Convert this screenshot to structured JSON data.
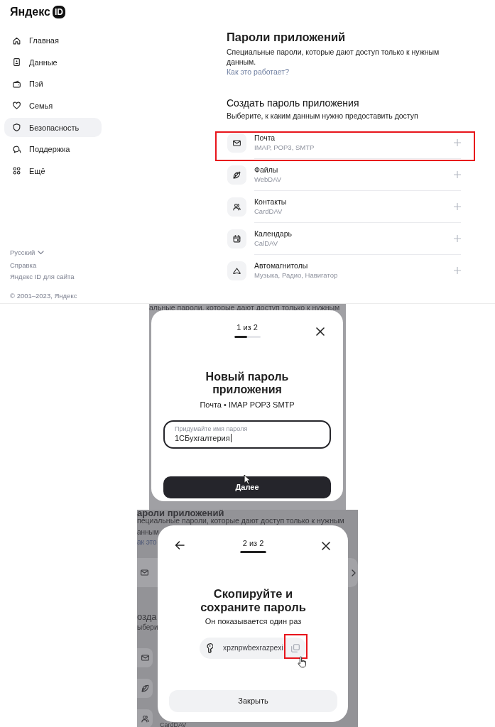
{
  "sidebar": {
    "logo": {
      "text": "Яндекс",
      "badge": "ID"
    },
    "items": [
      {
        "label": "Главная",
        "selected": false
      },
      {
        "label": "Данные",
        "selected": false
      },
      {
        "label": "Пэй",
        "selected": false
      },
      {
        "label": "Семья",
        "selected": false
      },
      {
        "label": "Безопасность",
        "selected": true
      },
      {
        "label": "Поддержка",
        "selected": false
      },
      {
        "label": "Ещё",
        "selected": false
      }
    ],
    "footer": {
      "language": "Русский",
      "links": [
        "Справка",
        "Яндекс ID для сайта"
      ],
      "copyright": "© 2001–2023, Яндекс"
    }
  },
  "main": {
    "title": "Пароли приложений",
    "description": "Специальные пароли, которые дают доступ только к нужным данным.",
    "link": "Как это работает?",
    "section_title": "Создать пароль приложения",
    "section_hint": "Выберите, к каким данным нужно предоставить доступ",
    "apps": [
      {
        "name": "Почта",
        "protocols": "IMAP, POP3, SMTP",
        "highlighted": true
      },
      {
        "name": "Файлы",
        "protocols": "WebDAV",
        "highlighted": false
      },
      {
        "name": "Контакты",
        "protocols": "CardDAV",
        "highlighted": false
      },
      {
        "name": "Календарь",
        "protocols": "CalDAV",
        "highlighted": false
      },
      {
        "name": "Автомагнитолы",
        "protocols": "Музыка, Радио, Навигатор",
        "highlighted": false
      }
    ]
  },
  "step_one": {
    "backdrop": {
      "text": "альные пароли, которые дают доступ только к нужным"
    },
    "modal": {
      "step": "1 из 2",
      "level": 0.5,
      "title": "Новый пароль приложения",
      "subtitle": "Почта • IMAP POP3 SMTP",
      "field": {
        "label": "Придумайте имя пароля",
        "value": "1СБухгалтерия"
      },
      "button": "Далее"
    }
  },
  "step_two": {
    "backdrop": {
      "title": "ароли приложений",
      "lines": [
        "пециальные пароли, которые дают доступ только к нужным",
        "анным"
      ],
      "link": "ак это",
      "section_title": "озда",
      "section_hint": "ыбери",
      "caption": "CardDAV"
    },
    "modal": {
      "step": "2 из 2",
      "level": 1,
      "title": "Скопируйте и сохраните пароль",
      "subtitle": "Он показывается один раз",
      "password": "xpznpwbexrazpexi",
      "copy_highlighted": true,
      "button": "Закрыть"
    }
  }
}
